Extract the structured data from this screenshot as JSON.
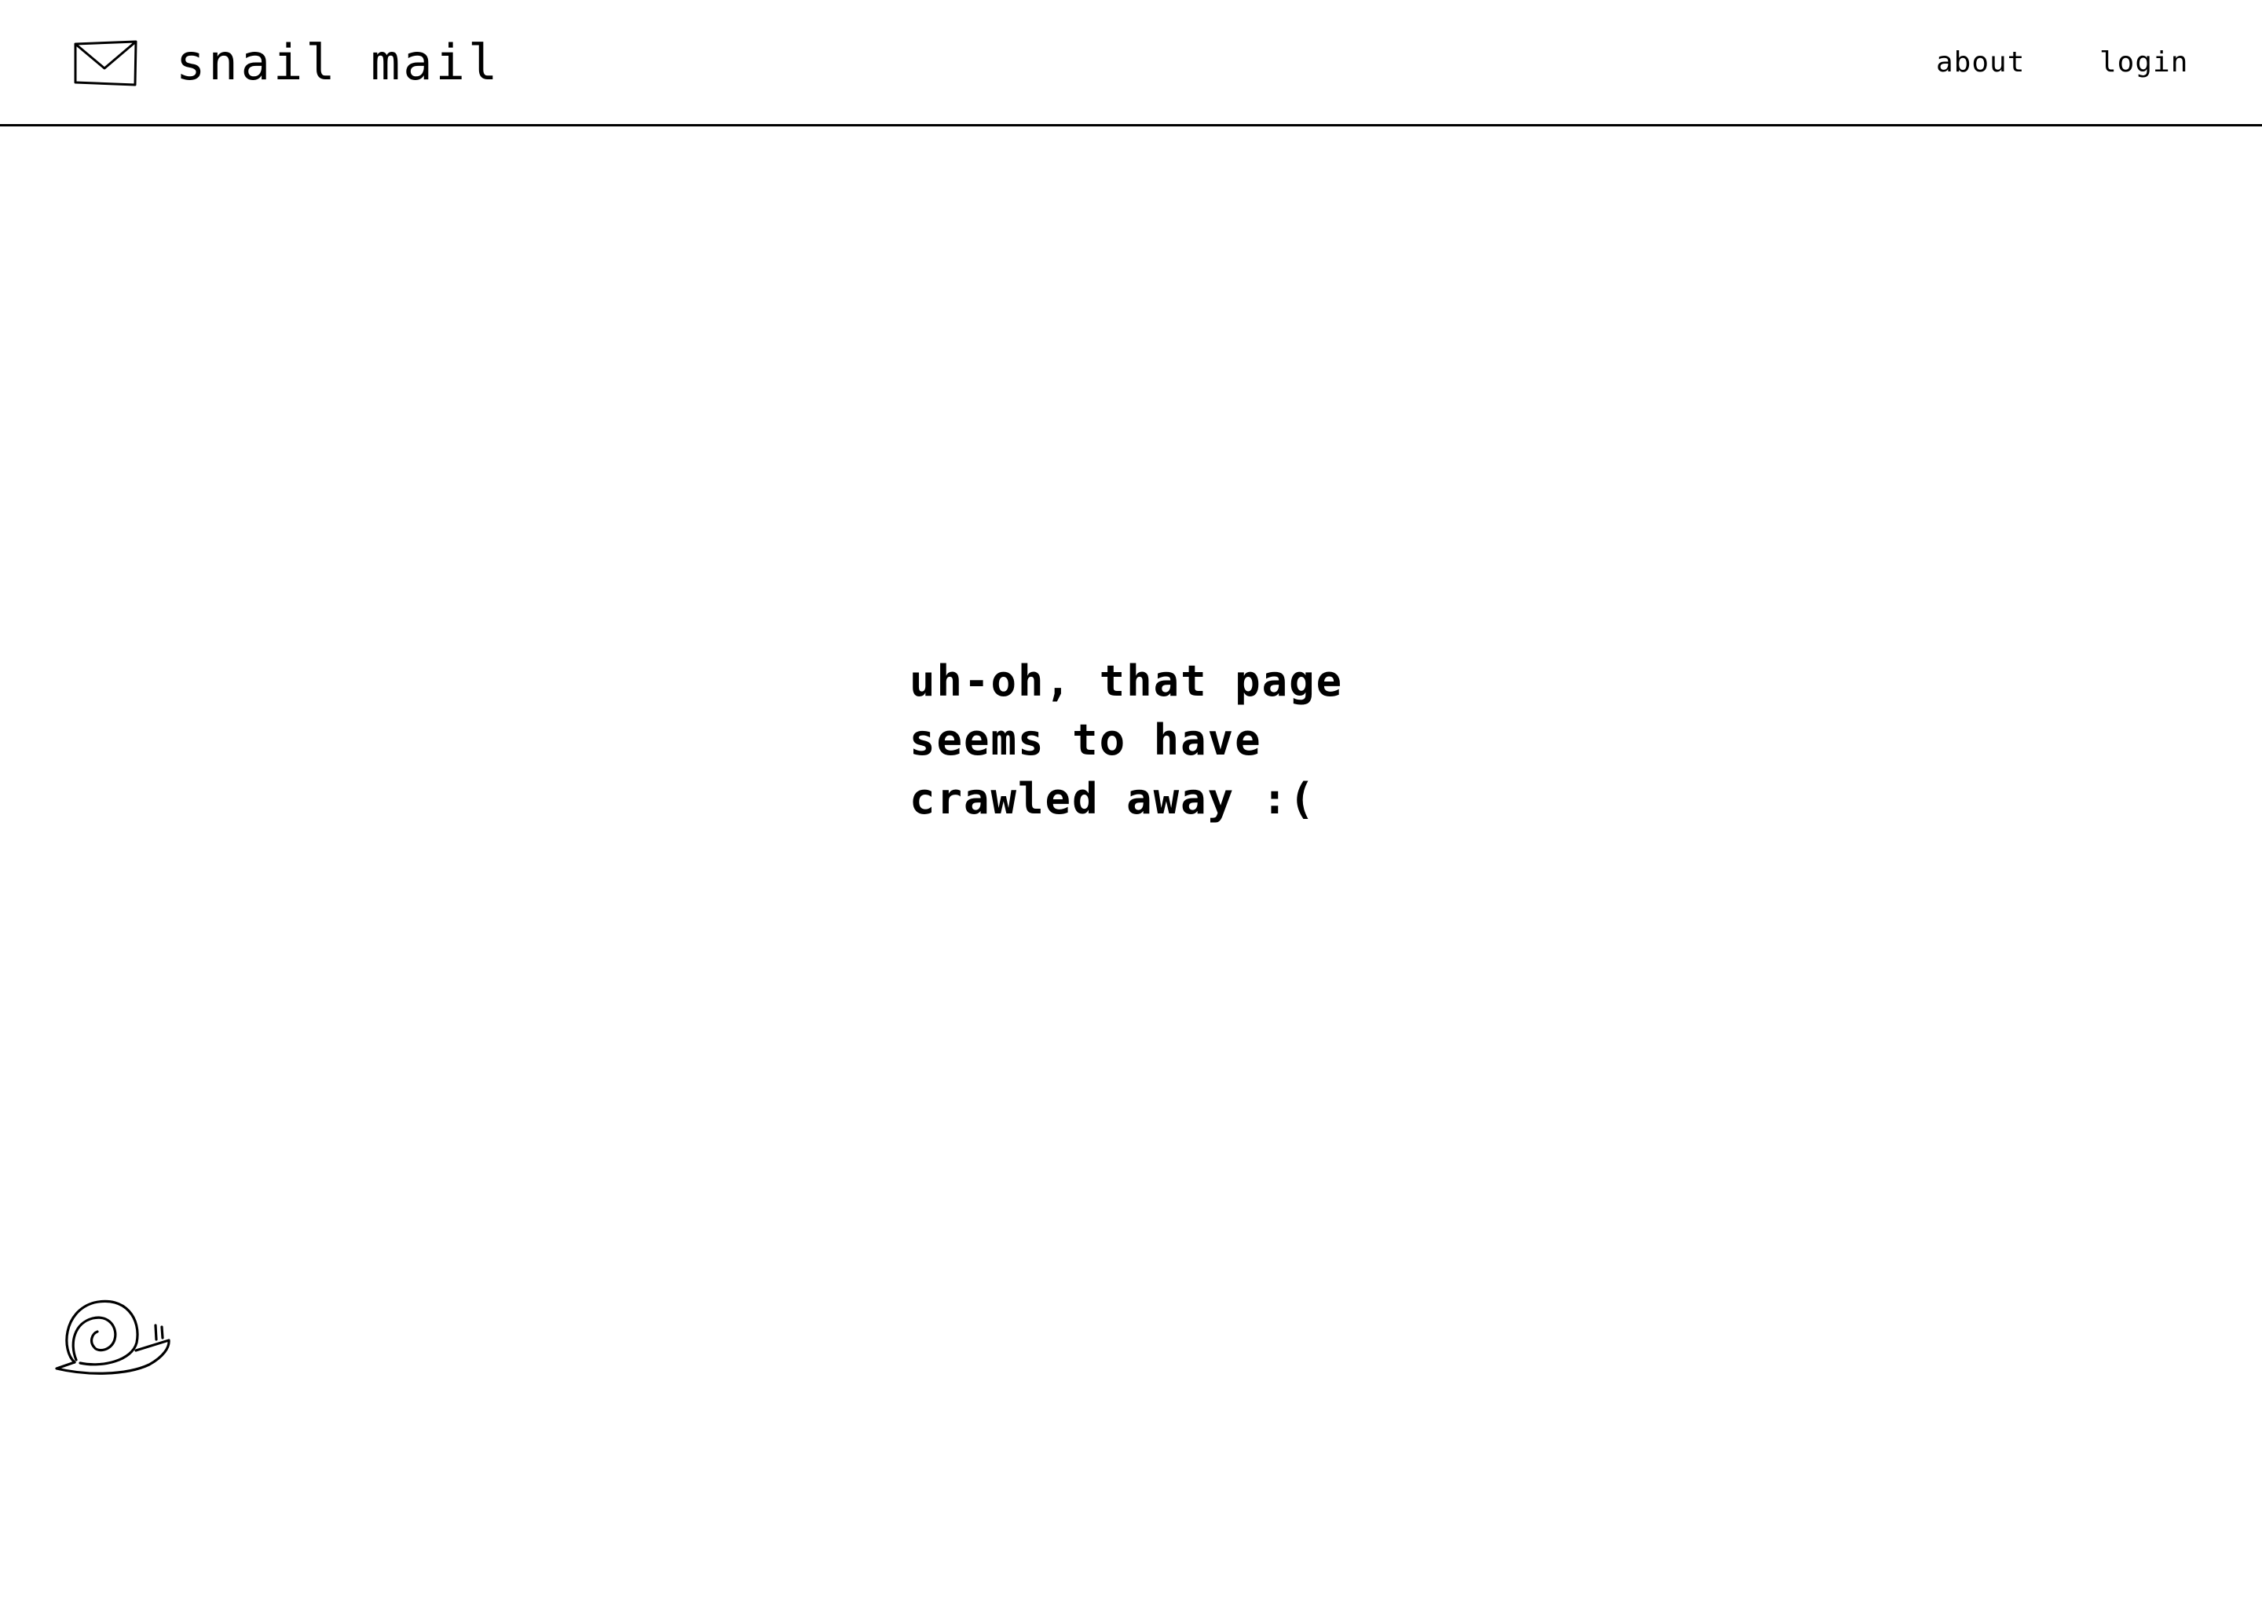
{
  "header": {
    "brand": "snail mail",
    "nav": {
      "about": "about",
      "login": "login"
    }
  },
  "main": {
    "message_lines": [
      "uh-oh, that page",
      "seems to have",
      "crawled away :("
    ]
  },
  "icons": {
    "logo": "envelope-icon",
    "footer": "snail-icon"
  }
}
